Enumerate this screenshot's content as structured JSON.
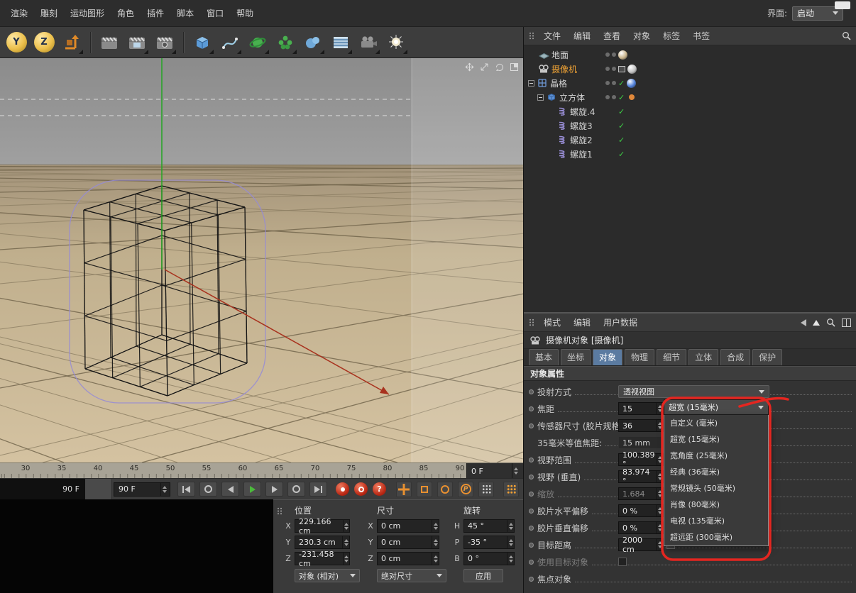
{
  "menu_bar": {
    "items": [
      "渲染",
      "雕刻",
      "运动图形",
      "角色",
      "插件",
      "脚本",
      "窗口",
      "帮助"
    ],
    "interface_label": "界面:",
    "interface_value": "启动"
  },
  "toolbar": {
    "tools": [
      {
        "name": "axis-y-tool",
        "kind": "ball",
        "glyph": "Y"
      },
      {
        "name": "axis-z-tool",
        "kind": "ball",
        "glyph": "Z"
      },
      {
        "name": "workplane-tool",
        "kind": "workplane",
        "sub": true
      },
      {
        "sep": true
      },
      {
        "name": "render-view-button",
        "kind": "render1"
      },
      {
        "name": "render-picture-viewer-button",
        "kind": "render2",
        "sub": true
      },
      {
        "name": "render-settings-button",
        "kind": "render3",
        "sub": true
      },
      {
        "sep": true
      },
      {
        "name": "add-cube-button",
        "kind": "cube",
        "sub": true
      },
      {
        "name": "add-spline-button",
        "kind": "pen",
        "sub": true
      },
      {
        "name": "add-mograph-button",
        "kind": "mograph",
        "sub": true
      },
      {
        "name": "add-effector-button",
        "kind": "effector",
        "sub": true
      },
      {
        "name": "add-metaball-button",
        "kind": "metaball",
        "sub": true
      },
      {
        "name": "add-environment-button",
        "kind": "env",
        "sub": true
      },
      {
        "name": "add-camera-button",
        "kind": "camtool",
        "sub": true
      },
      {
        "name": "add-light-button",
        "kind": "lighttool",
        "sub": true
      }
    ]
  },
  "viewport": {
    "nav_icons": [
      "pan-icon",
      "zoom-icon",
      "rotate-icon",
      "toggle-view-icon"
    ],
    "axis_y_color": "#23a523",
    "axis_x_color": "#a8321e",
    "cage_color": "#958bd6"
  },
  "timeline": {
    "ticks": [
      30,
      35,
      40,
      45,
      50,
      55,
      60,
      65,
      70,
      75,
      80,
      85,
      90
    ],
    "current_frame": "0 F"
  },
  "transport": {
    "range_end": "90 F",
    "frame_field": "90 F",
    "record_glyph": "?",
    "param_glyph": "P"
  },
  "coordinates": {
    "groups": [
      {
        "header": "位置",
        "footer": "对象 (相对)",
        "footer_type": "select",
        "rows": [
          [
            "X",
            "229.166 cm"
          ],
          [
            "Y",
            "230.3 cm"
          ],
          [
            "Z",
            "-231.458 cm"
          ]
        ]
      },
      {
        "header": "尺寸",
        "footer": "绝对尺寸",
        "footer_type": "select",
        "rows": [
          [
            "X",
            "0 cm"
          ],
          [
            "Y",
            "0 cm"
          ],
          [
            "Z",
            "0 cm"
          ]
        ]
      },
      {
        "header": "旋转",
        "footer": "应用",
        "footer_type": "button",
        "rows": [
          [
            "H",
            "45 °"
          ],
          [
            "P",
            "-35 °"
          ],
          [
            "B",
            "0 °"
          ]
        ]
      }
    ]
  },
  "object_manager": {
    "menu": [
      "文件",
      "编辑",
      "查看",
      "对象",
      "标签",
      "书签"
    ],
    "tree": [
      {
        "label": "地面",
        "icon": "floor",
        "depth": 0,
        "dots": true,
        "sphere": "#c9b48c"
      },
      {
        "label": "摄像机",
        "icon": "camera",
        "depth": 0,
        "dots": true,
        "selected": true,
        "display_box": true,
        "sphere": "#c2c2c2"
      },
      {
        "label": "晶格",
        "icon": "lattice",
        "depth": 0,
        "expander": true,
        "dots": true,
        "check": true,
        "sphere": "#4f7fd9"
      },
      {
        "label": "立方体",
        "icon": "cube",
        "depth": 1,
        "expander": true,
        "dots": true,
        "check": true,
        "dot_material": "#e0883a"
      },
      {
        "label": "螺旋.4",
        "icon": "spiral",
        "depth": 2,
        "check": true
      },
      {
        "label": "螺旋3",
        "icon": "spiral",
        "depth": 2,
        "check": true
      },
      {
        "label": "螺旋2",
        "icon": "spiral",
        "depth": 2,
        "check": true
      },
      {
        "label": "螺旋1",
        "icon": "spiral",
        "depth": 2,
        "check": true
      }
    ]
  },
  "attribute_manager": {
    "menu": [
      "模式",
      "编辑",
      "用户数据"
    ],
    "title": "摄像机对象 [摄像机]",
    "tabs": [
      "基本",
      "坐标",
      "对象",
      "物理",
      "细节",
      "立体",
      "合成",
      "保护"
    ],
    "active_tab": "对象",
    "section": "对象属性",
    "rows": [
      {
        "key": "projection",
        "label": "投射方式",
        "type": "select",
        "select": "透视视图"
      },
      {
        "key": "focal-length",
        "label": "焦距",
        "type": "numsel",
        "value": "15",
        "select": "超宽 (15毫米)"
      },
      {
        "key": "sensor-size",
        "label": "传感器尺寸 (胶片规格)",
        "type": "number",
        "value": "36"
      },
      {
        "key": "equiv-focal-35mm",
        "label": "35毫米等值焦距:",
        "type": "static",
        "value": "15 mm"
      },
      {
        "key": "fov-horizontal",
        "label": "视野范围",
        "type": "number",
        "value": "100.389 °"
      },
      {
        "key": "fov-vertical",
        "label": "视野 (垂直)",
        "type": "number",
        "value": "83.974 °"
      },
      {
        "key": "zoom",
        "label": "缩放",
        "type": "number",
        "value": "1.684",
        "disabled": true
      },
      {
        "key": "film-offset-x",
        "label": "胶片水平偏移",
        "type": "number",
        "value": "0 %"
      },
      {
        "key": "film-offset-y",
        "label": "胶片垂直偏移",
        "type": "number",
        "value": "0 %"
      },
      {
        "key": "target-distance",
        "label": "目标距离",
        "type": "number",
        "value": "2000 cm",
        "picker": true
      },
      {
        "key": "use-target-object",
        "label": "使用目标对象",
        "type": "checkbox",
        "disabled": true
      },
      {
        "key": "focus-object",
        "label": "焦点对象",
        "type": "none"
      }
    ],
    "dropdown": {
      "selected": "超宽 (15毫米)",
      "items": [
        "自定义 (毫米)",
        "超宽 (15毫米)",
        "宽角度 (25毫米)",
        "经典 (36毫米)",
        "常规镜头 (50毫米)",
        "肖像 (80毫米)",
        "电视 (135毫米)",
        "超远距 (300毫米)"
      ]
    }
  },
  "annotation": {
    "color": "#e42620"
  }
}
